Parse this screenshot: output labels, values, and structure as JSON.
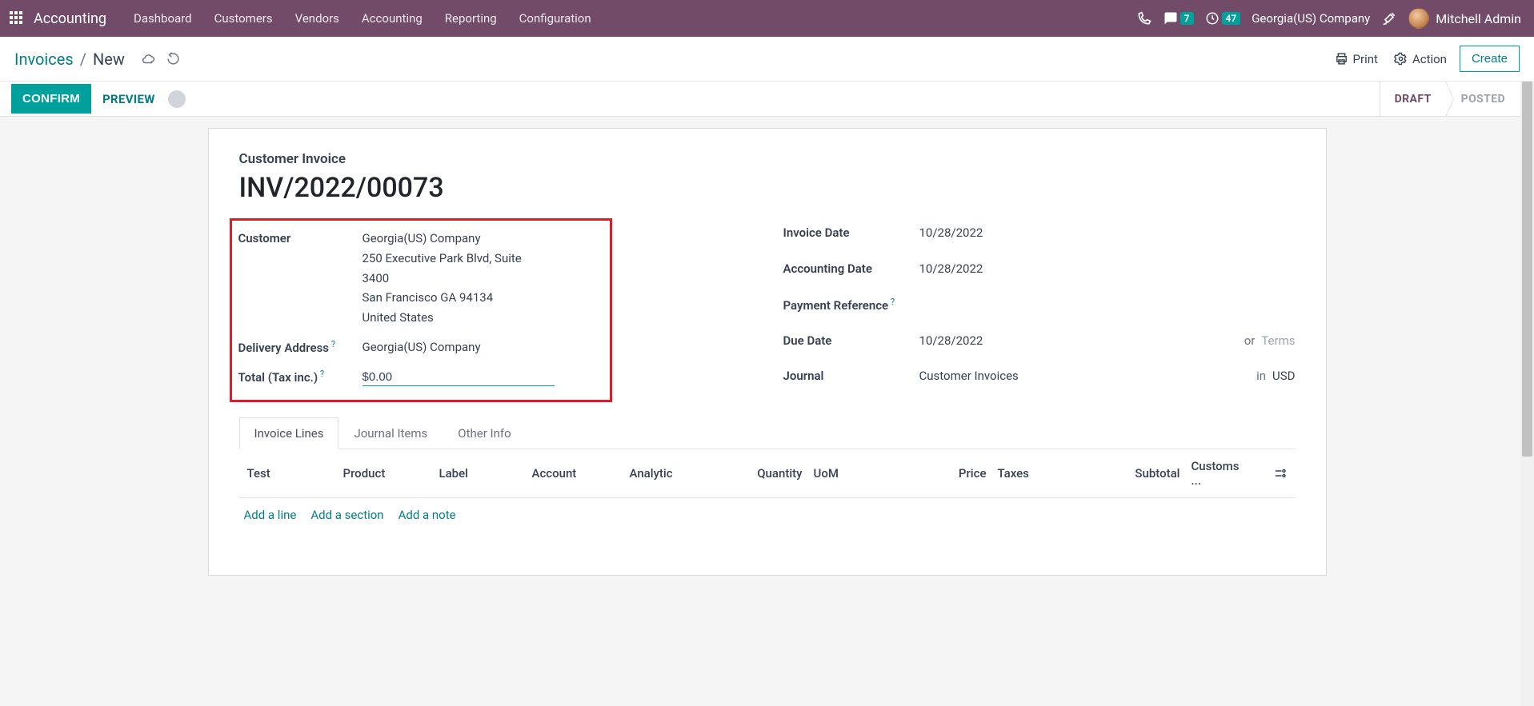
{
  "topbar": {
    "brand": "Accounting",
    "nav": [
      "Dashboard",
      "Customers",
      "Vendors",
      "Accounting",
      "Reporting",
      "Configuration"
    ],
    "messages_badge": "7",
    "activities_badge": "47",
    "company": "Georgia(US) Company",
    "user": "Mitchell Admin"
  },
  "breadcrumb": {
    "root": "Invoices",
    "current": "New"
  },
  "actions": {
    "print": "Print",
    "action": "Action",
    "create": "Create"
  },
  "statusbar": {
    "confirm": "CONFIRM",
    "preview": "PREVIEW",
    "steps": [
      "DRAFT",
      "POSTED"
    ]
  },
  "sheet": {
    "doc_type": "Customer Invoice",
    "doc_number": "INV/2022/00073",
    "left": {
      "customer_label": "Customer",
      "customer_name": "Georgia(US) Company",
      "customer_addr1": "250 Executive Park Blvd, Suite 3400",
      "customer_addr2": "San Francisco GA 94134",
      "customer_country": "United States",
      "delivery_label": "Delivery Address",
      "delivery_value": "Georgia(US) Company",
      "total_label": "Total (Tax inc.)",
      "total_value": "$0.00"
    },
    "right": {
      "invoice_date_label": "Invoice Date",
      "invoice_date_value": "10/28/2022",
      "accounting_date_label": "Accounting Date",
      "accounting_date_value": "10/28/2022",
      "payment_ref_label": "Payment Reference",
      "due_date_label": "Due Date",
      "due_date_value": "10/28/2022",
      "due_or": "or",
      "terms_placeholder": "Terms",
      "journal_label": "Journal",
      "journal_value": "Customer Invoices",
      "journal_in": "in",
      "currency": "USD"
    },
    "tabs": [
      "Invoice Lines",
      "Journal Items",
      "Other Info"
    ],
    "columns": {
      "test": "Test",
      "product": "Product",
      "label": "Label",
      "account": "Account",
      "analytic": "Analytic",
      "quantity": "Quantity",
      "uom": "UoM",
      "price": "Price",
      "taxes": "Taxes",
      "subtotal": "Subtotal",
      "customs": "Customs ..."
    },
    "row_actions": {
      "add_line": "Add a line",
      "add_section": "Add a section",
      "add_note": "Add a note"
    }
  }
}
